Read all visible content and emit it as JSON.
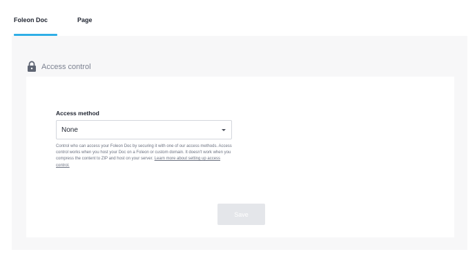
{
  "tabs": [
    {
      "label": "Foleon Doc",
      "active": true
    },
    {
      "label": "Page",
      "active": false
    }
  ],
  "section": {
    "icon": "lock-icon",
    "title": "Access control"
  },
  "access": {
    "label": "Access method",
    "selected": "None",
    "help_text": "Control who can access your Foleon Doc by securing it with one of our access methods. Access control works when you host your Doc on a Foleon or custom domain. It doesn't work when you compress the content to ZIP and host on your server. ",
    "help_link": "Learn more about setting up access control."
  },
  "save_label": "Save",
  "colors": {
    "accent": "#2eaee6",
    "panel_bg": "#f7f7f8",
    "disabled_button": "#e4e6ea"
  }
}
